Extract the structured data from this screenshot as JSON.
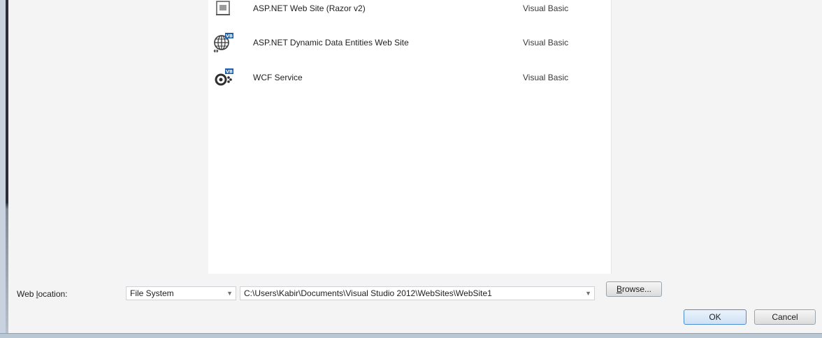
{
  "templates": [
    {
      "name": "ASP.NET Web Site (Razor v2)",
      "language": "Visual Basic",
      "icon": "razor-page-icon"
    },
    {
      "name": "ASP.NET Dynamic Data Entities Web Site",
      "language": "Visual Basic",
      "icon": "globe-vb-icon"
    },
    {
      "name": "WCF Service",
      "language": "Visual Basic",
      "icon": "gear-vb-icon"
    }
  ],
  "web_location": {
    "label_pre": "Web ",
    "label_underlined": "l",
    "label_post": "ocation:",
    "type_value": "File System",
    "path_value": "C:\\Users\\Kabir\\Documents\\Visual Studio 2012\\WebSites\\WebSite1"
  },
  "buttons": {
    "browse_underlined": "B",
    "browse_rest": "rowse...",
    "ok": "OK",
    "cancel": "Cancel"
  },
  "colors": {
    "panel_bg": "#f4f4f4",
    "vb_badge": "#1f5fa8",
    "default_button_border": "#4c8dd6"
  }
}
